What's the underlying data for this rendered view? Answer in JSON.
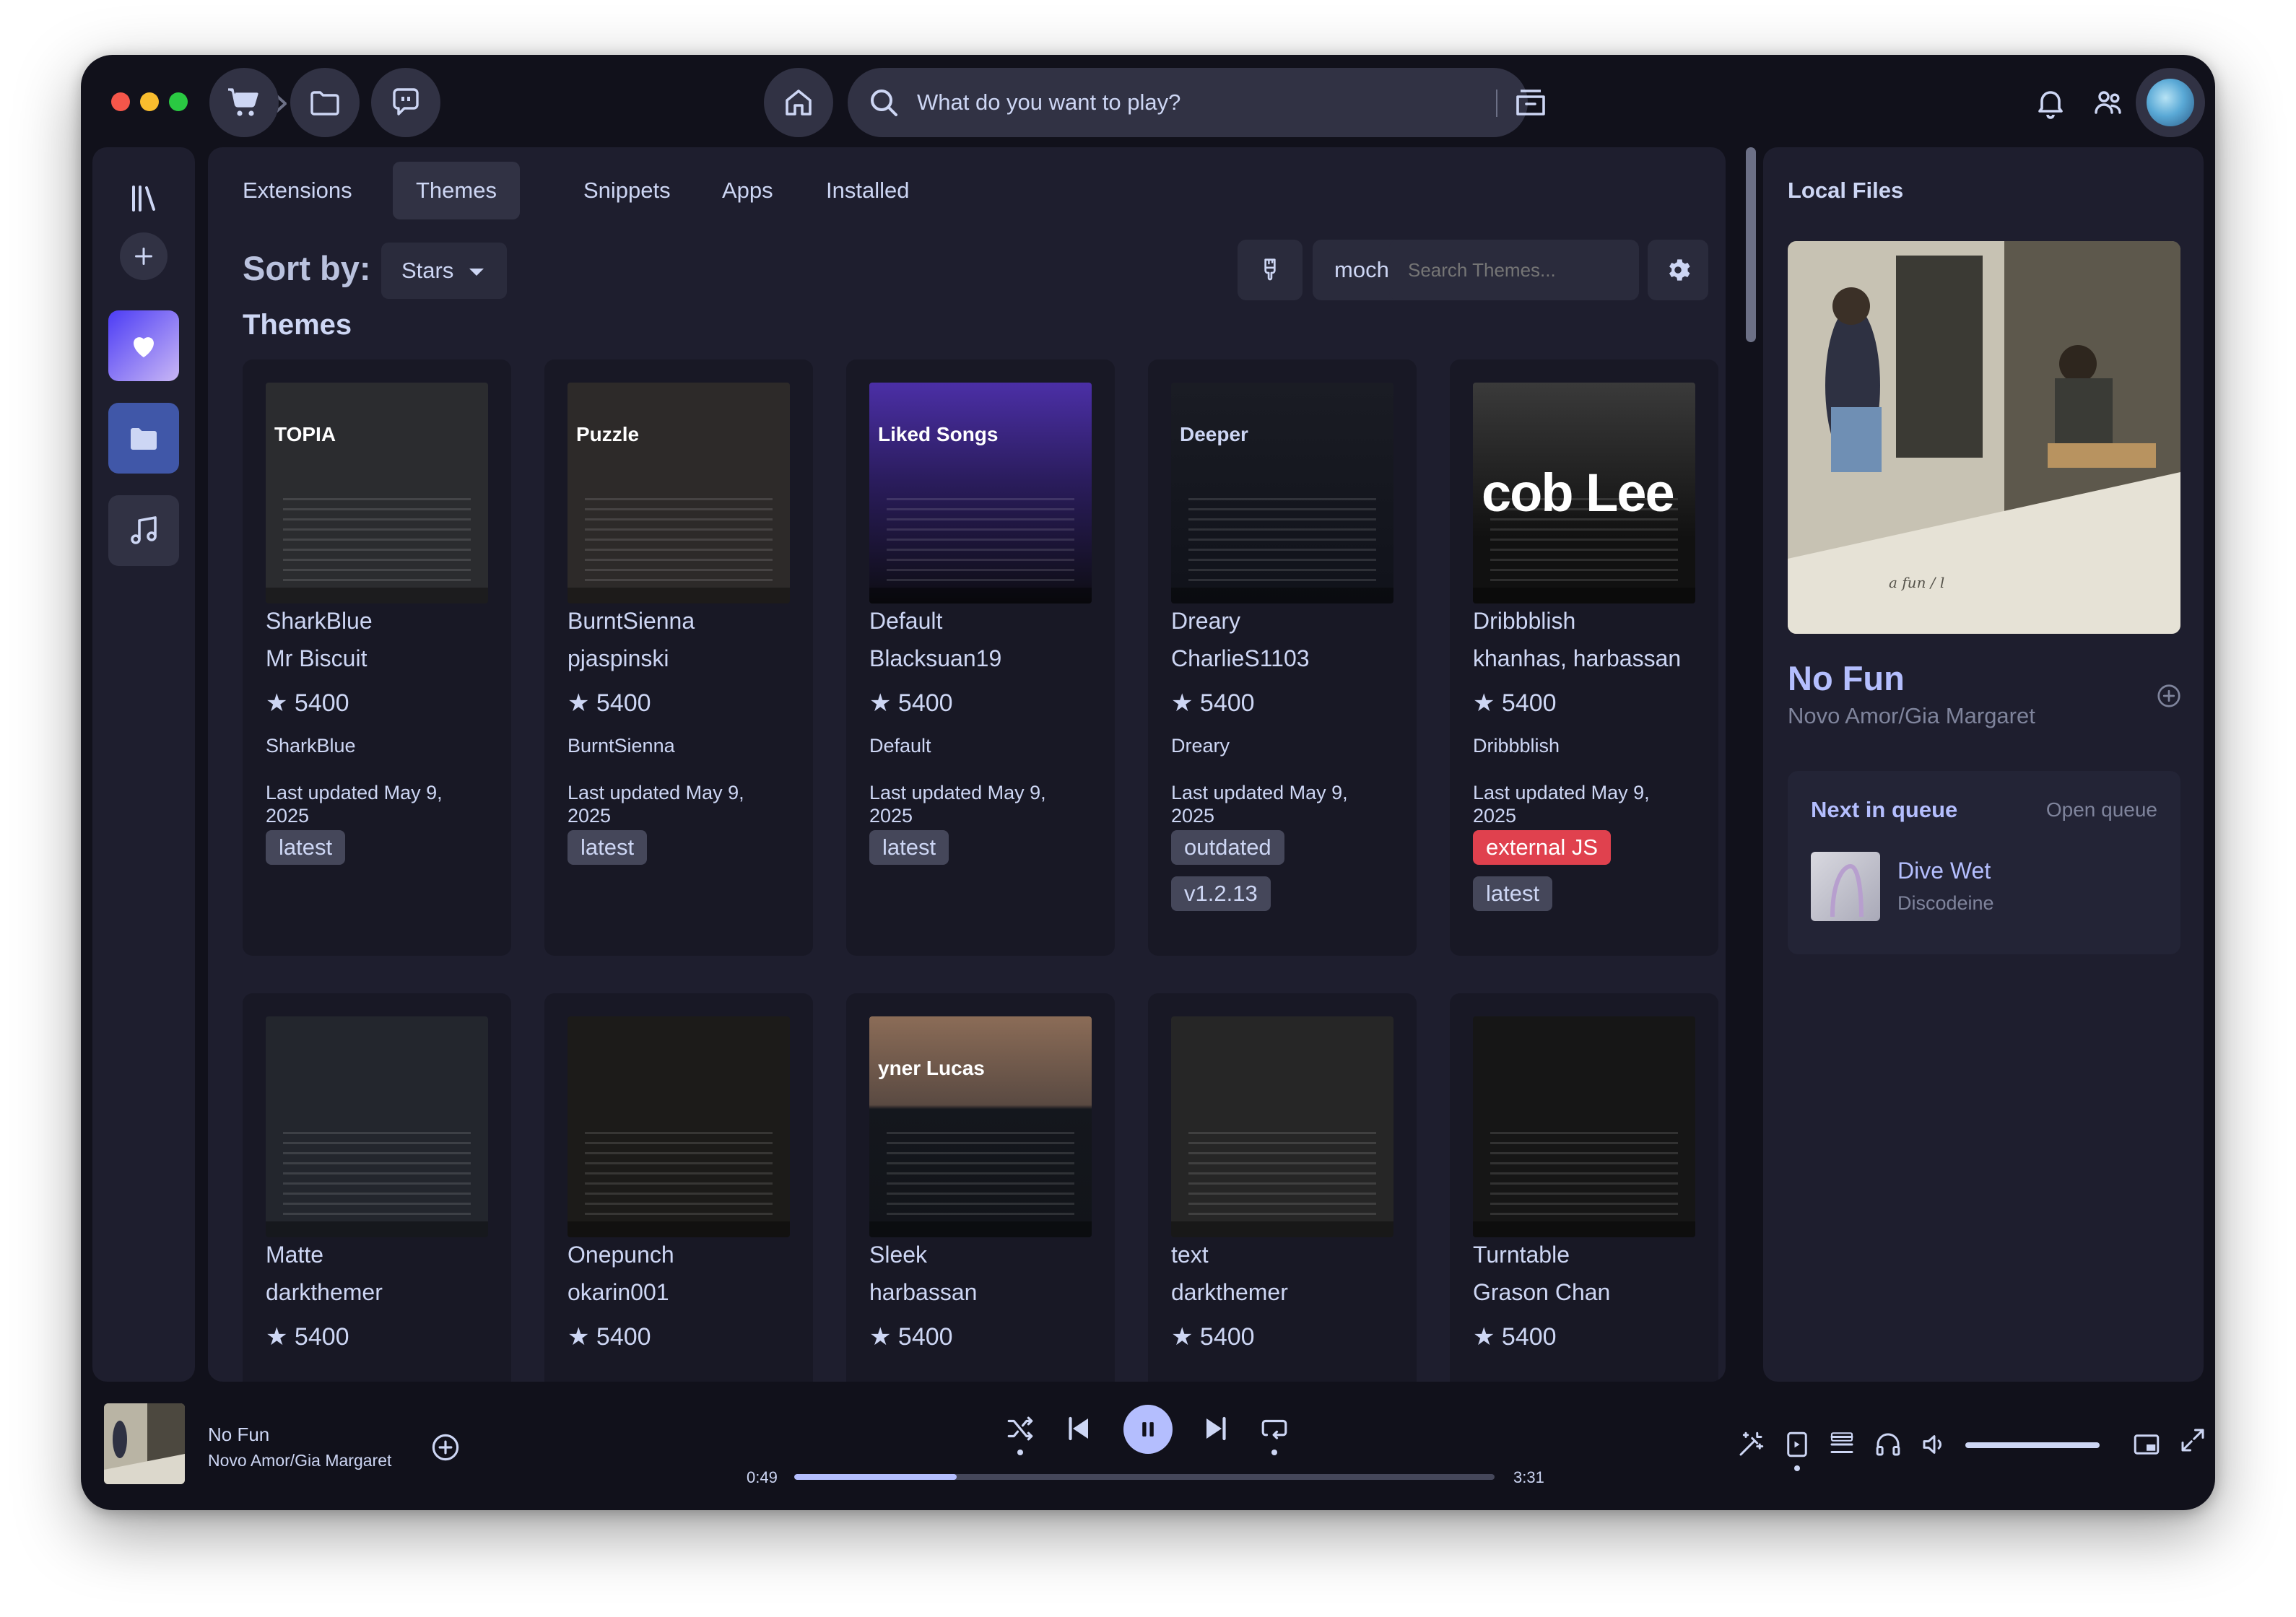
{
  "search": {
    "placeholder": "What do you want to play?"
  },
  "tabs": [
    "Extensions",
    "Themes",
    "Snippets",
    "Apps",
    "Installed"
  ],
  "active_tab": "Themes",
  "sort": {
    "label": "Sort by:",
    "value": "Stars"
  },
  "filter": {
    "flavor": "mocha",
    "search_placeholder": "Search Themes..."
  },
  "section_title": "Themes",
  "cards": [
    {
      "name": "SharkBlue",
      "author": "Mr Biscuit",
      "stars": "★ 5400",
      "desc": "SharkBlue",
      "updated": "Last updated May 9, 2025",
      "tags": [
        "latest"
      ],
      "thumb_text": "TOPIA"
    },
    {
      "name": "BurntSienna",
      "author": "pjaspinski",
      "stars": "★ 5400",
      "desc": "BurntSienna",
      "updated": "Last updated May 9, 2025",
      "tags": [
        "latest"
      ],
      "thumb_text": "Puzzle"
    },
    {
      "name": "Default",
      "author": "Blacksuan19",
      "stars": "★ 5400",
      "desc": "Default",
      "updated": "Last updated May 9, 2025",
      "tags": [
        "latest"
      ],
      "thumb_text": "Liked Songs"
    },
    {
      "name": "Dreary",
      "author": "CharlieS1103",
      "stars": "★ 5400",
      "desc": "Dreary",
      "updated": "Last updated May 9, 2025",
      "tags": [
        "outdated",
        "v1.2.13"
      ],
      "thumb_text": "Deeper"
    },
    {
      "name": "Dribbblish",
      "author": "khanhas, harbassan",
      "stars": "★ 5400",
      "desc": "Dribbblish",
      "updated": "Last updated May 9, 2025",
      "tags": [
        "external JS",
        "latest"
      ],
      "thumb_text": "cob Lee"
    },
    {
      "name": "Matte",
      "author": "darkthemer",
      "stars": "★ 5400"
    },
    {
      "name": "Onepunch",
      "author": "okarin001",
      "stars": "★ 5400"
    },
    {
      "name": "Sleek",
      "author": "harbassan",
      "stars": "★ 5400",
      "thumb_text": "yner Lucas"
    },
    {
      "name": "text",
      "author": "darkthemer",
      "stars": "★ 5400"
    },
    {
      "name": "Turntable",
      "author": "Grason Chan",
      "stars": "★ 5400"
    }
  ],
  "right_panel": {
    "title": "Local Files",
    "song": "No Fun",
    "artist": "Novo Amor/Gia Margaret",
    "queue": {
      "title": "Next in queue",
      "open": "Open queue",
      "song": "Dive Wet",
      "artist": "Discodeine"
    }
  },
  "player": {
    "song": "No Fun",
    "artist": "Novo Amor/Gia Margaret",
    "elapsed": "0:49",
    "duration": "3:31",
    "progress": 0.232,
    "volume": 1.0
  },
  "colors": {
    "accent": "#b4befe",
    "base": "#1e1e2e",
    "crust": "#11111b",
    "surface": "#313244",
    "red_tag": "#e0414e"
  }
}
